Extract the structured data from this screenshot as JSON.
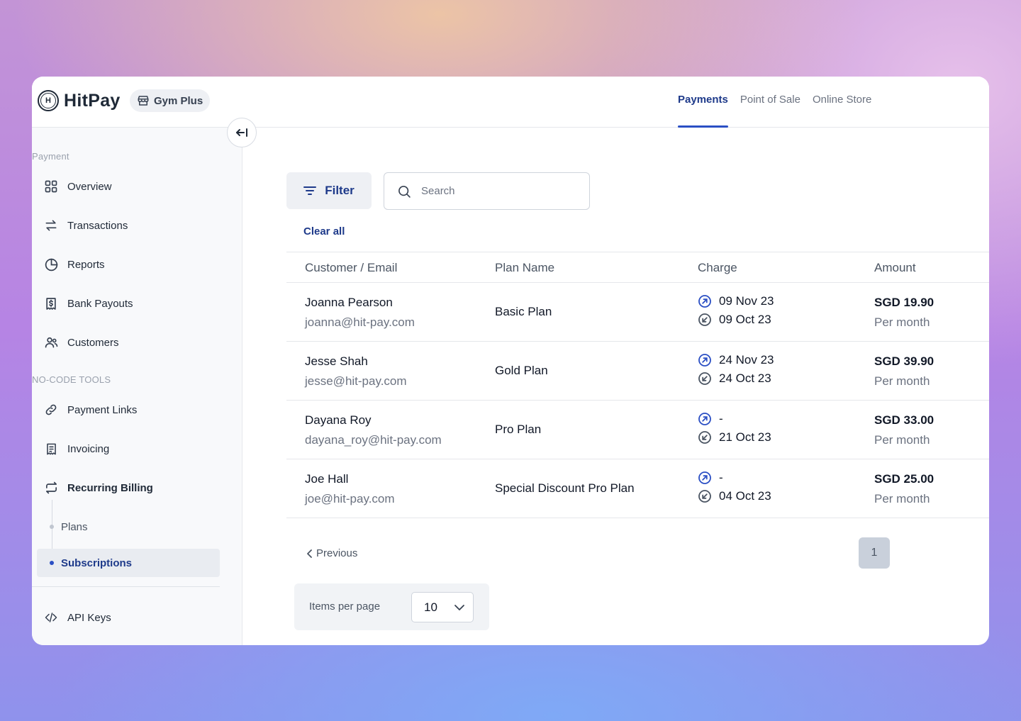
{
  "brand": {
    "name": "HitPay",
    "logo_letter": "H"
  },
  "store": {
    "name": "Gym Plus"
  },
  "nav_tabs": [
    {
      "label": "Payments",
      "active": true
    },
    {
      "label": "Point of Sale",
      "active": false
    },
    {
      "label": "Online Store",
      "active": false
    }
  ],
  "sidebar": {
    "section_payment": "Payment",
    "section_tools": "NO-CODE TOOLS",
    "items": [
      {
        "label": "Overview",
        "icon": "grid-icon"
      },
      {
        "label": "Transactions",
        "icon": "arrows-swap-icon"
      },
      {
        "label": "Reports",
        "icon": "pie-chart-icon"
      },
      {
        "label": "Bank Payouts",
        "icon": "dollar-doc-icon"
      },
      {
        "label": "Customers",
        "icon": "users-icon"
      },
      {
        "label": "Payment Links",
        "icon": "link-icon"
      },
      {
        "label": "Invoicing",
        "icon": "invoice-icon"
      },
      {
        "label": "Recurring Billing",
        "icon": "repeat-icon"
      }
    ],
    "sub_items": [
      {
        "label": "Plans",
        "active": false
      },
      {
        "label": "Subscriptions",
        "active": true
      }
    ],
    "api_keys": "API Keys"
  },
  "toolbar": {
    "filter_label": "Filter",
    "search_placeholder": "Search",
    "clear_all": "Clear all"
  },
  "table": {
    "headers": [
      "Customer / Email",
      "Plan Name",
      "Charge",
      "Amount"
    ],
    "rows": [
      {
        "name": "Joanna Pearson",
        "email": "joanna@hit-pay.com",
        "plan": "Basic Plan",
        "next_charge": "09 Nov 23",
        "last_charge": "09 Oct 23",
        "amount": "SGD 19.90",
        "period": "Per month"
      },
      {
        "name": "Jesse Shah",
        "email": "jesse@hit-pay.com",
        "plan": "Gold Plan",
        "next_charge": "24 Nov 23",
        "last_charge": "24 Oct 23",
        "amount": "SGD 39.90",
        "period": "Per month"
      },
      {
        "name": "Dayana Roy",
        "email": "dayana_roy@hit-pay.com",
        "plan": "Pro Plan",
        "next_charge": "-",
        "last_charge": "21 Oct 23",
        "amount": "SGD 33.00",
        "period": "Per month"
      },
      {
        "name": "Joe Hall",
        "email": "joe@hit-pay.com",
        "plan": "Special Discount Pro Plan",
        "next_charge": "-",
        "last_charge": "04 Oct 23",
        "amount": "SGD 25.00",
        "period": "Per month"
      }
    ]
  },
  "pagination": {
    "previous_label": "Previous",
    "current_page": "1",
    "items_per_page_label": "Items per page",
    "items_per_page_value": "10"
  },
  "colors": {
    "accent": "#2b4fc4",
    "primary_text": "#1e3a8a"
  }
}
